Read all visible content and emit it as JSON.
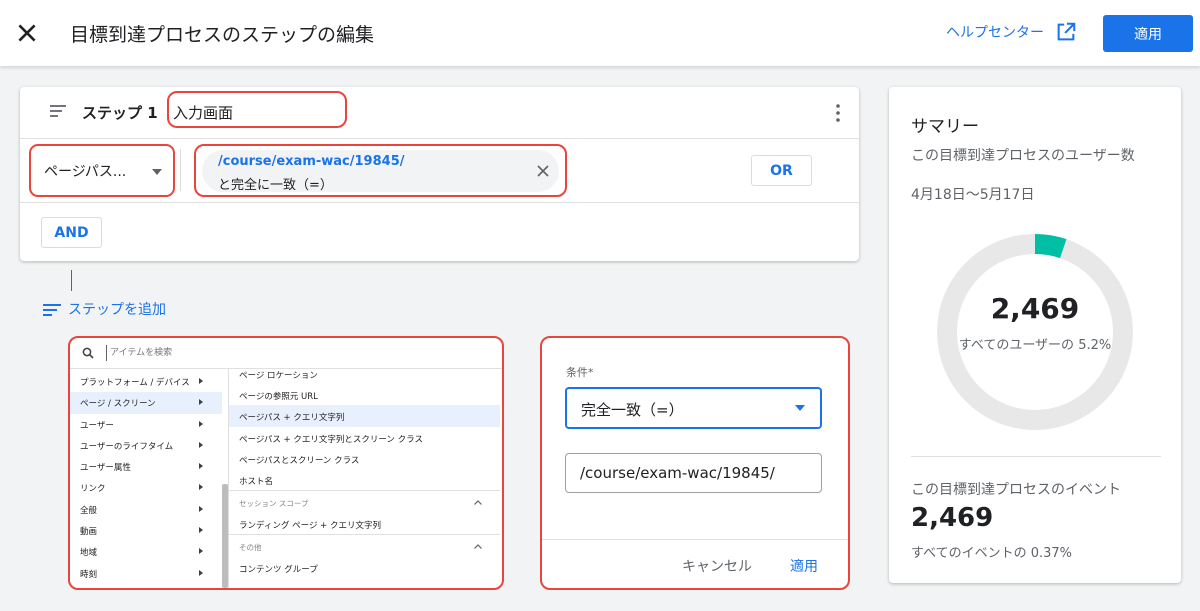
{
  "header": {
    "title": "目標到達プロセスのステップの編集",
    "help_label": "ヘルプセンター",
    "apply_label": "適用"
  },
  "step": {
    "label": "ステップ 1",
    "name": "入力画面",
    "dimension": "ページパス...",
    "condition_value": "/course/exam-wac/19845/",
    "condition_type": "と完全に一致（=）",
    "or_label": "OR",
    "and_label": "AND"
  },
  "add_step_label": "ステップを追加",
  "picker": {
    "search_placeholder": "アイテムを検索",
    "categories": [
      {
        "label": "プラットフォーム / デバイス"
      },
      {
        "label": "ページ / スクリーン"
      },
      {
        "label": "ユーザー"
      },
      {
        "label": "ユーザーのライフタイム"
      },
      {
        "label": "ユーザー属性"
      },
      {
        "label": "リンク"
      },
      {
        "label": "全般"
      },
      {
        "label": "動画"
      },
      {
        "label": "地域"
      },
      {
        "label": "時刻"
      }
    ],
    "options": [
      {
        "label": "ページ ロケーション"
      },
      {
        "label": "ページの参照元 URL"
      },
      {
        "label": "ページパス + クエリ文字列"
      },
      {
        "label": "ページパス + クエリ文字列とスクリーン クラス"
      },
      {
        "label": "ページパスとスクリーン クラス"
      },
      {
        "label": "ホスト名"
      }
    ],
    "section_session": "セッション スコープ",
    "session_option": "ランディング ページ + クエリ文字列",
    "section_other": "その他",
    "other_option": "コンテンツ グループ"
  },
  "condition_panel": {
    "label": "条件*",
    "selected": "完全一致（=）",
    "value": "/course/exam-wac/19845/",
    "cancel_label": "キャンセル",
    "apply_label": "適用"
  },
  "summary": {
    "title": "サマリー",
    "users_label": "この目標到達プロセスのユーザー数",
    "date_range": "4月18日〜5月17日",
    "users_value": "2,469",
    "users_pct_text": "すべてのユーザーの 5.2%",
    "users_fraction": 0.052,
    "events_label": "この目標到達プロセスのイベント",
    "events_value": "2,469",
    "events_pct_text": "すべてのイベントの 0.37%"
  },
  "colors": {
    "accent": "#1a73e8",
    "donut_fill": "#00bfa5",
    "donut_track": "#e8e8e8",
    "highlight": "#e8453c"
  }
}
